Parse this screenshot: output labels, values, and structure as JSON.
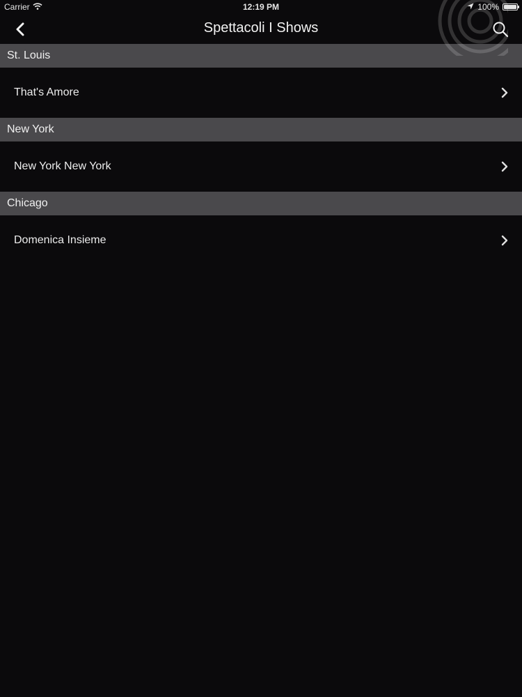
{
  "status_bar": {
    "carrier": "Carrier",
    "time": "12:19 PM",
    "battery": "100%",
    "battery_level": 1.0
  },
  "nav": {
    "title": "Spettacoli I Shows"
  },
  "sections": [
    {
      "header": "St. Louis",
      "items": [
        {
          "label": "That's Amore"
        }
      ]
    },
    {
      "header": "New York",
      "items": [
        {
          "label": "New York New York"
        }
      ]
    },
    {
      "header": "Chicago",
      "items": [
        {
          "label": "Domenica Insieme"
        }
      ]
    }
  ],
  "colors": {
    "background": "#0b0a0c",
    "section_header": "#4a494c",
    "text": "#ececec"
  },
  "icons": {
    "back": "chevron-left-icon",
    "search": "search-icon",
    "row_accessory": "chevron-right-icon",
    "wifi": "wifi-icon",
    "location": "location-arrow-icon",
    "battery": "battery-icon"
  }
}
